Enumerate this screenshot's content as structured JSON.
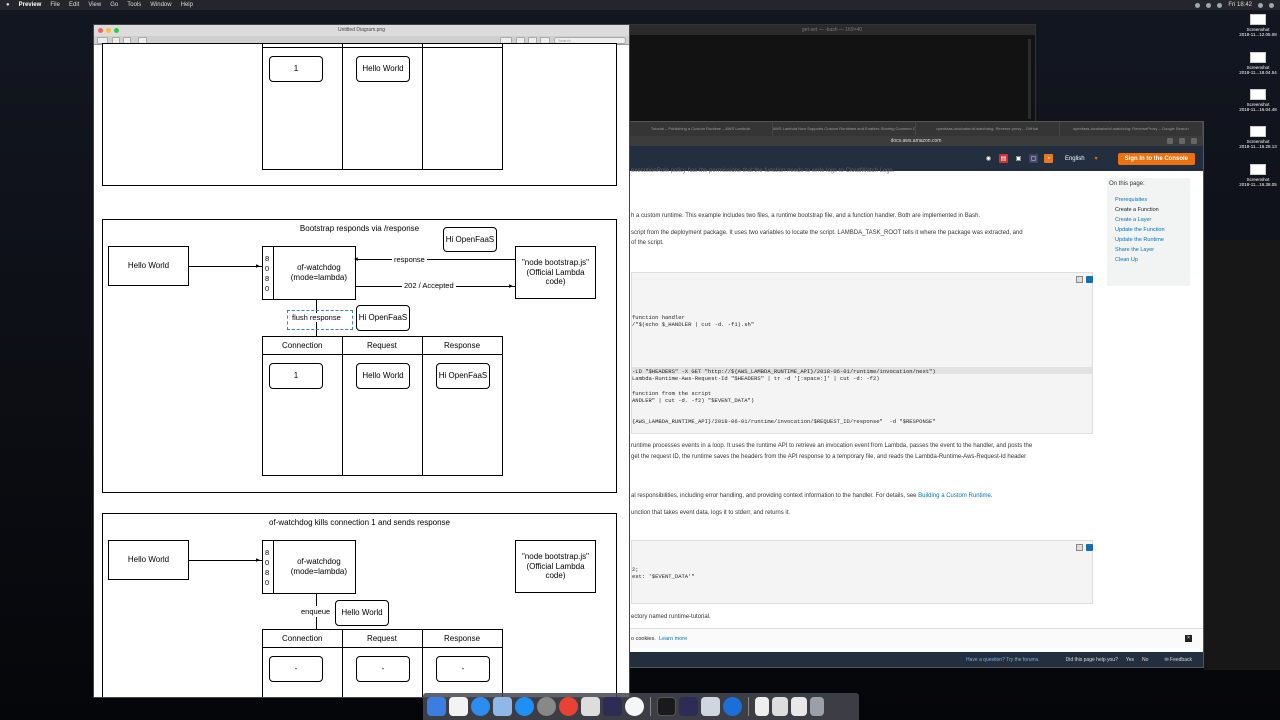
{
  "menubar": {
    "app": "Preview",
    "items": [
      "File",
      "Edit",
      "View",
      "Go",
      "Tools",
      "Window",
      "Help"
    ],
    "clock": "Fri 18:42"
  },
  "terminal": {
    "title": "get-set — -bash — 169×40"
  },
  "browser": {
    "tabs": [
      "Tutorial – Publishing a Custom Runtime – AWS Lambda",
      "AWS Lambda Now Supports Custom Runtimes and Enables Sharing Common Code Between Functions",
      "openfaas-incubator/of-watchdog: Reverse proxy – GitHub",
      "openfaas-incubator/of-watchdog: ReverseProxy – Google Search"
    ],
    "url": "docs.aws.amazon.com",
    "language": "English",
    "signin": "Sign In to the Console",
    "doc": {
      "l1": "executionRole policy has the permissions that the function needs to write logs to CloudWatch Logs.",
      "l2": "h a custom runtime. This example includes two files, a runtime bootstrap file, and a function handler. Both are implemented in Bash.",
      "l3": "script from the deployment package. It uses two variables to locate the script. LAMBDA_TASK_ROOT tells it where the package was extracted, and",
      "l4": "of the script.",
      "code1": [
        "function handler",
        "/\"$(echo $_HANDLER | cut -d. -f1).sh\"",
        "",
        "",
        "",
        "-LD \"$HEADERS\" -X GET \"http://${AWS_LAMBDA_RUNTIME_API}/2018-06-01/runtime/invocation/next\")",
        "Lambda-Runtime-Aws-Request-Id \"$HEADERS\" | tr -d '[:space:]' | cut -d: -f2)",
        "",
        "function from the script",
        "ANDLER\" | cut -d. -f2) \"$EVENT_DATA\")",
        "",
        "{AWS_LAMBDA_RUNTIME_API}/2018-06-01/runtime/invocation/$REQUEST_ID/response\"  -d \"$RESPONSE\""
      ],
      "l5": "runtime processes events in a loop. It uses the runtime API to retrieve an invocation event from Lambda, passes the event to the handler, and posts the",
      "l6": "get the request ID, the runtime saves the headers from the API response to a temporary file, and reads the Lambda-Runtime-Aws-Request-Id header",
      "l7": "al responsibilities, including error handling, and providing context information to the handler. For details, see",
      "l7link": "Building a Custom Runtime",
      "l8": "unction that takes event data, logs it to stderr, and returns it.",
      "code2": [
        "2;",
        "est: '$EVENT_DATA'\""
      ],
      "l9": "ectory named runtime-tutorial."
    },
    "toc": {
      "heading": "On this page:",
      "items": [
        "Prerequisites",
        "Create a Function",
        "Create a Layer",
        "Update the Function",
        "Update the Runtime",
        "Share the Layer",
        "Clean Up"
      ]
    },
    "cookie": {
      "text": "o cookies.",
      "link": "Learn more",
      "close": "×"
    },
    "footer": {
      "question": "Have a question? Try the forums.",
      "helpful": "Did this page help you?",
      "yes": "Yes",
      "no": "No",
      "feedback": "Feedback"
    }
  },
  "desktop_icons": [
    {
      "line1": "Screenshot",
      "line2": "2018-11...12.05.08"
    },
    {
      "line1": "Screenshot",
      "line2": "2018-11...18.04.54"
    },
    {
      "line1": "Screenshot",
      "line2": "2018-11...16.04.48"
    },
    {
      "line1": "Screenshot",
      "line2": "2018-11...16.28.13"
    },
    {
      "line1": "Screenshot",
      "line2": "2018-11...16.38.05"
    }
  ],
  "preview": {
    "title": "Untitled Diagram.png",
    "search_placeholder": "Search",
    "top": {
      "cell1": "1",
      "cell2": "Hello World"
    },
    "mid": {
      "title": "Bootstrap responds via /response",
      "client": "Hello World",
      "port": [
        "8",
        "0",
        "8",
        "0"
      ],
      "watchdog": "of-watchdog\n(mode=lambda)",
      "node": "\"node bootstrap.js\"\n(Official Lambda\ncode)",
      "response_label": "response",
      "accepted_label": "202 / Accepted",
      "bubble1": "Hi OpenFaaS",
      "flush_label": "flush response",
      "bubble2": "Hi OpenFaaS",
      "headers": [
        "Connection",
        "Request",
        "Response"
      ],
      "cells": [
        "1",
        "Hello World",
        "Hi OpenFaaS"
      ]
    },
    "bottom": {
      "title": "of-watchdog kills connection 1 and sends response",
      "client": "Hello World",
      "port": [
        "8",
        "0",
        "8",
        "0"
      ],
      "watchdog": "of-watchdog\n(mode=lambda)",
      "node": "\"node bootstrap.js\"\n(Official Lambda\ncode)",
      "enqueue_label": "enqueue",
      "bubble": "Hello World",
      "headers": [
        "Connection",
        "Request",
        "Response"
      ],
      "cells": [
        "-",
        "-",
        "-"
      ]
    }
  }
}
